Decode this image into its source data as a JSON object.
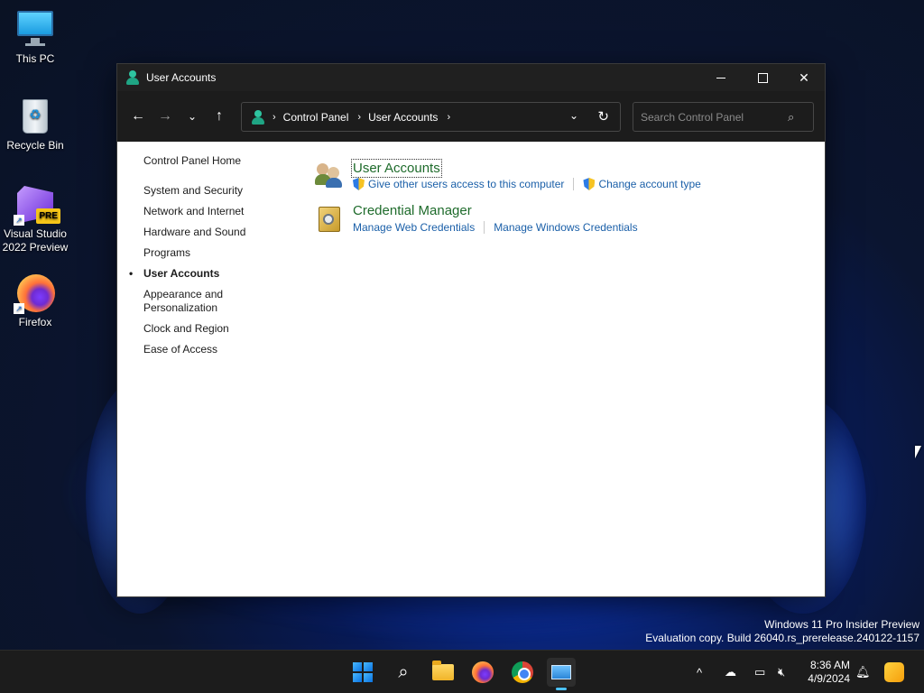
{
  "desktop": {
    "icons": [
      {
        "label": "This PC"
      },
      {
        "label": "Recycle Bin"
      },
      {
        "label": "Visual Studio 2022 Preview"
      },
      {
        "label": "Firefox"
      }
    ],
    "vs_badge": "PRE"
  },
  "window": {
    "title": "User Accounts",
    "breadcrumb": [
      "Control Panel",
      "User Accounts"
    ],
    "search_placeholder": "Search Control Panel"
  },
  "sidebar": {
    "home": "Control Panel Home",
    "items": [
      {
        "label": "System and Security",
        "active": false
      },
      {
        "label": "Network and Internet",
        "active": false
      },
      {
        "label": "Hardware and Sound",
        "active": false
      },
      {
        "label": "Programs",
        "active": false
      },
      {
        "label": "User Accounts",
        "active": true
      },
      {
        "label": "Appearance and Personalization",
        "active": false
      },
      {
        "label": "Clock and Region",
        "active": false
      },
      {
        "label": "Ease of Access",
        "active": false
      }
    ]
  },
  "main": {
    "sections": [
      {
        "title": "User Accounts",
        "icon": "users-icon",
        "links": [
          {
            "label": "Give other users access to this computer",
            "shield": true
          },
          {
            "label": "Change account type",
            "shield": true
          }
        ]
      },
      {
        "title": "Credential Manager",
        "icon": "credential-safe-icon",
        "links": [
          {
            "label": "Manage Web Credentials",
            "shield": false
          },
          {
            "label": "Manage Windows Credentials",
            "shield": false
          }
        ]
      }
    ]
  },
  "watermark": {
    "line1": "Windows 11 Pro Insider Preview",
    "line2": "Evaluation copy. Build 26040.rs_prerelease.240122-1157"
  },
  "taskbar": {
    "time": "8:36 AM",
    "date": "4/9/2024",
    "apps": [
      "start-icon",
      "search-icon",
      "file-explorer-icon",
      "firefox-icon",
      "chrome-icon",
      "control-panel-icon"
    ]
  },
  "colors": {
    "link": "#1a5fa8",
    "section_title": "#1e6b2b",
    "titlebar": "#202020"
  }
}
